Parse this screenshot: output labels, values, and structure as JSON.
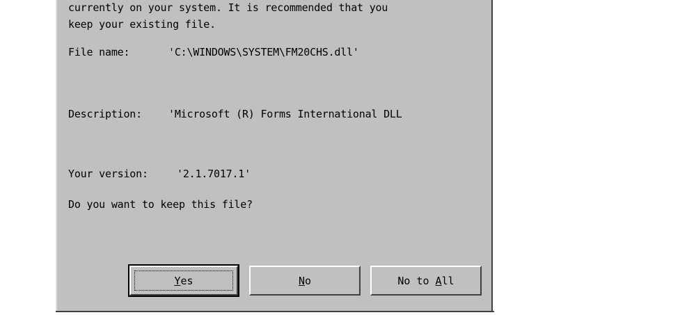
{
  "message": {
    "line1": "currently on your system. It is recommended that you",
    "line2": "keep your existing file."
  },
  "file_name": {
    "label": "File name:",
    "value": "'C:\\WINDOWS\\SYSTEM\\FM20CHS.dll'"
  },
  "description": {
    "label": "Description:",
    "value": "'Microsoft (R) Forms International DLL"
  },
  "version": {
    "label": "Your version:",
    "value": "'2.1.7017.1'"
  },
  "question": "Do you want to keep this file?",
  "buttons": {
    "yes": {
      "mnemonic": "Y",
      "rest": "es"
    },
    "no": {
      "mnemonic": "N",
      "rest": "o"
    },
    "no_to_all": {
      "prefix": "No to ",
      "mnemonic": "A",
      "rest": "ll"
    }
  },
  "colors": {
    "dialog_bg": "#c0c0c0",
    "text": "#000000"
  }
}
